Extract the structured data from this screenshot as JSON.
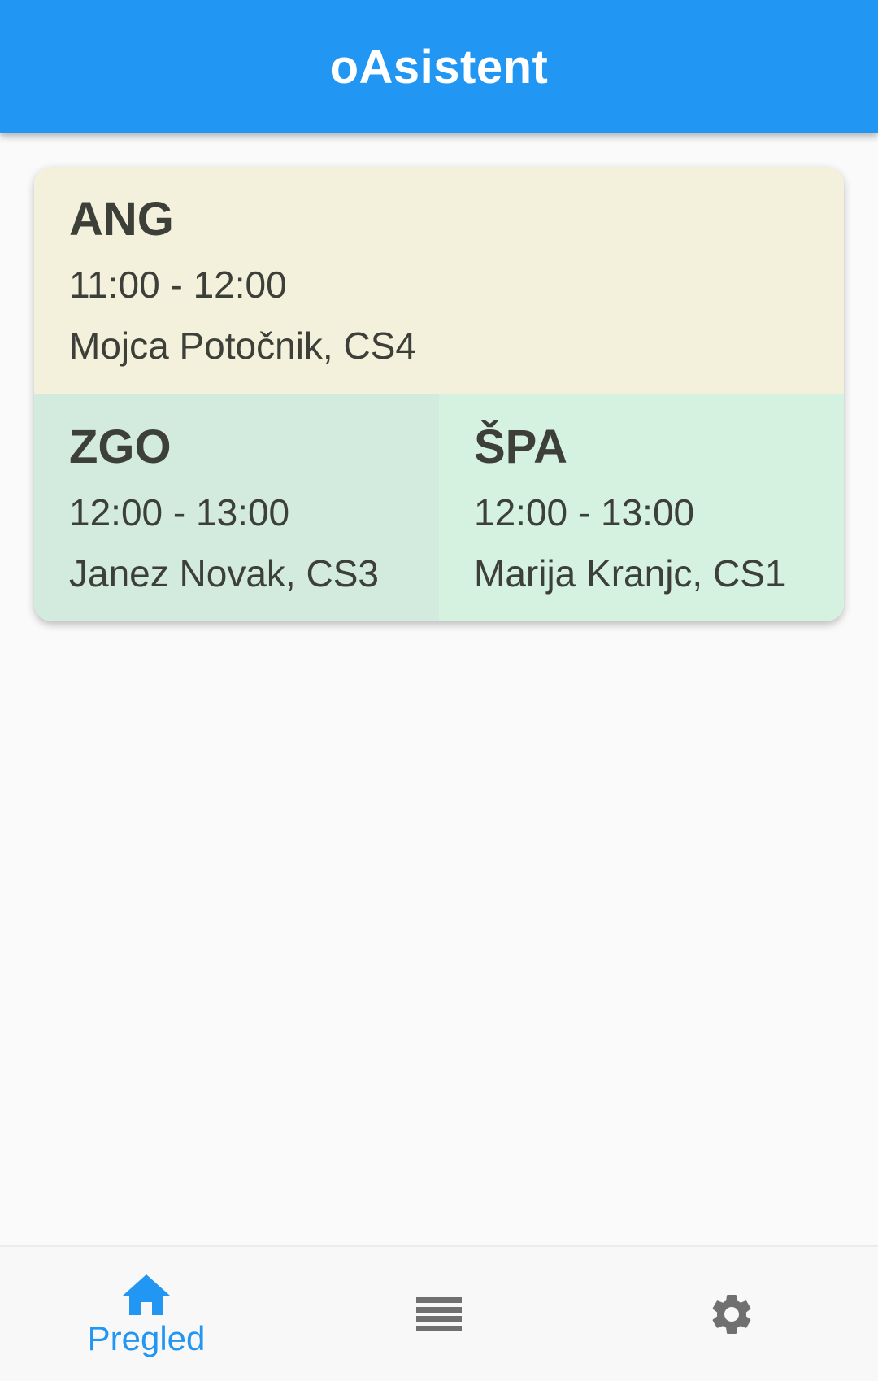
{
  "app_bar": {
    "title": "oAsistent",
    "color": "#2196f3"
  },
  "timetable": {
    "lessons": [
      {
        "subject": "ANG",
        "time": "11:00 - 12:00",
        "teacher_room": "Mojca Potočnik, CS4",
        "color": "#f3f1dc"
      },
      {
        "subject": "ZGO",
        "time": "12:00 - 13:00",
        "teacher_room": "Janez Novak, CS3",
        "color": "#d3eadf"
      },
      {
        "subject": "ŠPA",
        "time": "12:00 - 13:00",
        "teacher_room": "Marija Kranjc, CS1",
        "color": "#d5f2e0"
      }
    ]
  },
  "bottom_nav": {
    "active_color": "#2196f3",
    "inactive_color": "#707070",
    "items": [
      {
        "icon": "home-icon",
        "label": "Pregled",
        "active": true
      },
      {
        "icon": "list-icon",
        "label": "",
        "active": false
      },
      {
        "icon": "gear-icon",
        "label": "",
        "active": false
      }
    ]
  }
}
